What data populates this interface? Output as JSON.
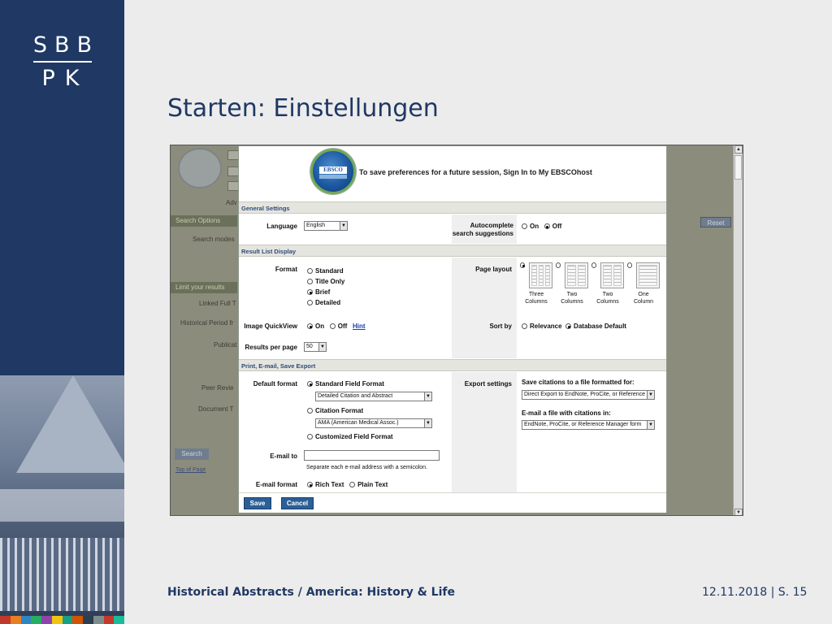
{
  "logo": {
    "line1": "SBB",
    "line2": "PK"
  },
  "slide": {
    "title": "Starten: Einstellungen",
    "footer_left": "Historical Abstracts / America: History & Life",
    "footer_right": "12.11.2018 | S. 15"
  },
  "colors": {
    "sidebar": "#1f3864",
    "accent_bar": [
      "#c0392b",
      "#e67e22",
      "#2e86c1",
      "#27ae60",
      "#8e44ad",
      "#f1c40f",
      "#16a085",
      "#d35400",
      "#2c3e50",
      "#7f8c8d",
      "#c0392b",
      "#1abc9c"
    ]
  },
  "background_ui": {
    "adv": "Adv",
    "search_options": "Search Options",
    "reset": "Reset",
    "search_modes": "Search modes",
    "limit_results": "Limit your results",
    "linked_full": "Linked Full T",
    "historical_period": "Historical Period fr",
    "publication": "Publicat",
    "peer_review": "Peer Revie",
    "document_type": "Document T",
    "search_button": "Search",
    "top_of_page": "Top of Page"
  },
  "modal": {
    "logo_text": "EBSCO",
    "logo_sub": "HOST",
    "header_message": "To save preferences for a future session, Sign In to My EBSCOhost",
    "sections": {
      "general": "General Settings",
      "result_list": "Result List Display",
      "print_email": "Print, E-mail, Save Export"
    },
    "language_label": "Language",
    "language_value": "English",
    "autocomplete_label_1": "Autocomplete",
    "autocomplete_label_2": "search suggestions",
    "autocomplete_on": "On",
    "autocomplete_off": "Off",
    "format_label": "Format",
    "format_options": [
      "Standard",
      "Title Only",
      "Brief",
      "Detailed"
    ],
    "format_selected": "Brief",
    "page_layout_label": "Page layout",
    "layouts": [
      {
        "line1": "Three",
        "line2": "Columns",
        "selected": true
      },
      {
        "line1": "Two",
        "line2": "Columns",
        "selected": false
      },
      {
        "line1": "Two",
        "line2": "Columns",
        "selected": false
      },
      {
        "line1": "One",
        "line2": "Column",
        "selected": false
      }
    ],
    "image_quickview_label": "Image QuickView",
    "quickview_on": "On",
    "quickview_off": "Off",
    "hint": "Hint",
    "sort_by_label": "Sort by",
    "sort_relevance": "Relevance",
    "sort_default": "Database Default",
    "results_per_page_label": "Results per page",
    "results_per_page_value": "50",
    "default_format_label": "Default format",
    "standard_field_format": "Standard Field Format",
    "standard_field_select": "Detailed Citation and Abstract",
    "citation_format": "Citation Format",
    "citation_select": "AMA (American Medical Assoc.)",
    "customized_field_format": "Customized Field Format",
    "export_settings_label": "Export settings",
    "save_citations_label": "Save citations to a file formatted for:",
    "save_citations_value": "Direct Export to EndNote, ProCite, or Reference",
    "email_citations_label": "E-mail a file with citations in:",
    "email_citations_value": "EndNote, ProCite, or Reference Manager form",
    "email_to_label": "E-mail to",
    "email_to_value": "",
    "email_help": "Separate each e-mail address with a semicolon.",
    "email_format_label": "E-mail format",
    "rich_text": "Rich Text",
    "plain_text": "Plain Text",
    "save_button": "Save",
    "cancel_button": "Cancel"
  }
}
